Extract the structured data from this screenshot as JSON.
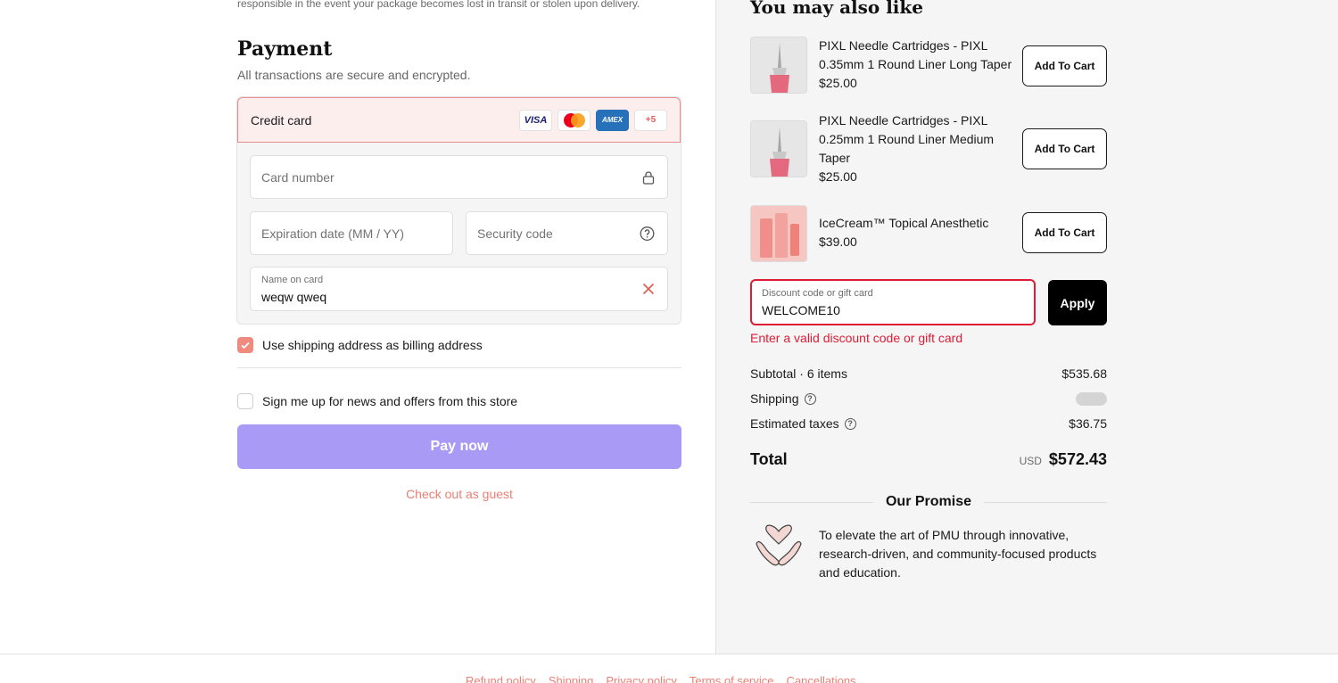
{
  "notice": {
    "text": "responsible in the event your package becomes lost in transit or stolen upon delivery."
  },
  "payment": {
    "title": "Payment",
    "subtitle": "All transactions are secure and encrypted.",
    "method_label": "Credit card",
    "brands": {
      "visa": "VISA",
      "amex": "AMEX",
      "more": "+5"
    },
    "card_number_placeholder": "Card number",
    "expiry_placeholder": "Expiration date (MM / YY)",
    "security_placeholder": "Security code",
    "name_label": "Name on card",
    "name_value": "weqw qweq",
    "billing_checkbox": {
      "label": "Use shipping address as billing address",
      "checked": true
    },
    "newsletter_checkbox": {
      "label": "Sign me up for news and offers from this store",
      "checked": false
    },
    "pay_button": "Pay now",
    "guest_link": "Check out as guest"
  },
  "recommendations": {
    "title": "You may also like",
    "items": [
      {
        "name": "PIXL Needle Cartridges - PIXL 0.35mm 1 Round Liner Long Taper",
        "price": "$25.00",
        "button": "Add To Cart"
      },
      {
        "name": "PIXL Needle Cartridges - PIXL 0.25mm 1 Round Liner Medium Taper",
        "price": "$25.00",
        "button": "Add To Cart"
      },
      {
        "name": "IceCream™ Topical Anesthetic",
        "price": "$39.00",
        "button": "Add To Cart"
      }
    ]
  },
  "discount": {
    "label": "Discount code or gift card",
    "value": "WELCOME10",
    "apply": "Apply",
    "error": "Enter a valid discount code or gift card"
  },
  "summary": {
    "subtotal_label": "Subtotal · 6 items",
    "subtotal_value": "$535.68",
    "shipping_label": "Shipping",
    "taxes_label": "Estimated taxes",
    "taxes_value": "$36.75",
    "total_label": "Total",
    "currency": "USD",
    "total_value": "$572.43"
  },
  "promise": {
    "title": "Our Promise",
    "text": "To elevate the art of PMU through innovative, research-driven, and community-focused products and education."
  },
  "footer": {
    "links": [
      "Refund policy",
      "Shipping",
      "Privacy policy",
      "Terms of service",
      "Cancellations"
    ]
  },
  "colors": {
    "accent": "#a99af5",
    "link": "#ec7f74",
    "error": "#dd1d35",
    "checkbox": "#f08a7e"
  },
  "icons": [
    "lock-icon",
    "question-icon",
    "clear-icon",
    "check-icon",
    "hands-heart-icon"
  ]
}
